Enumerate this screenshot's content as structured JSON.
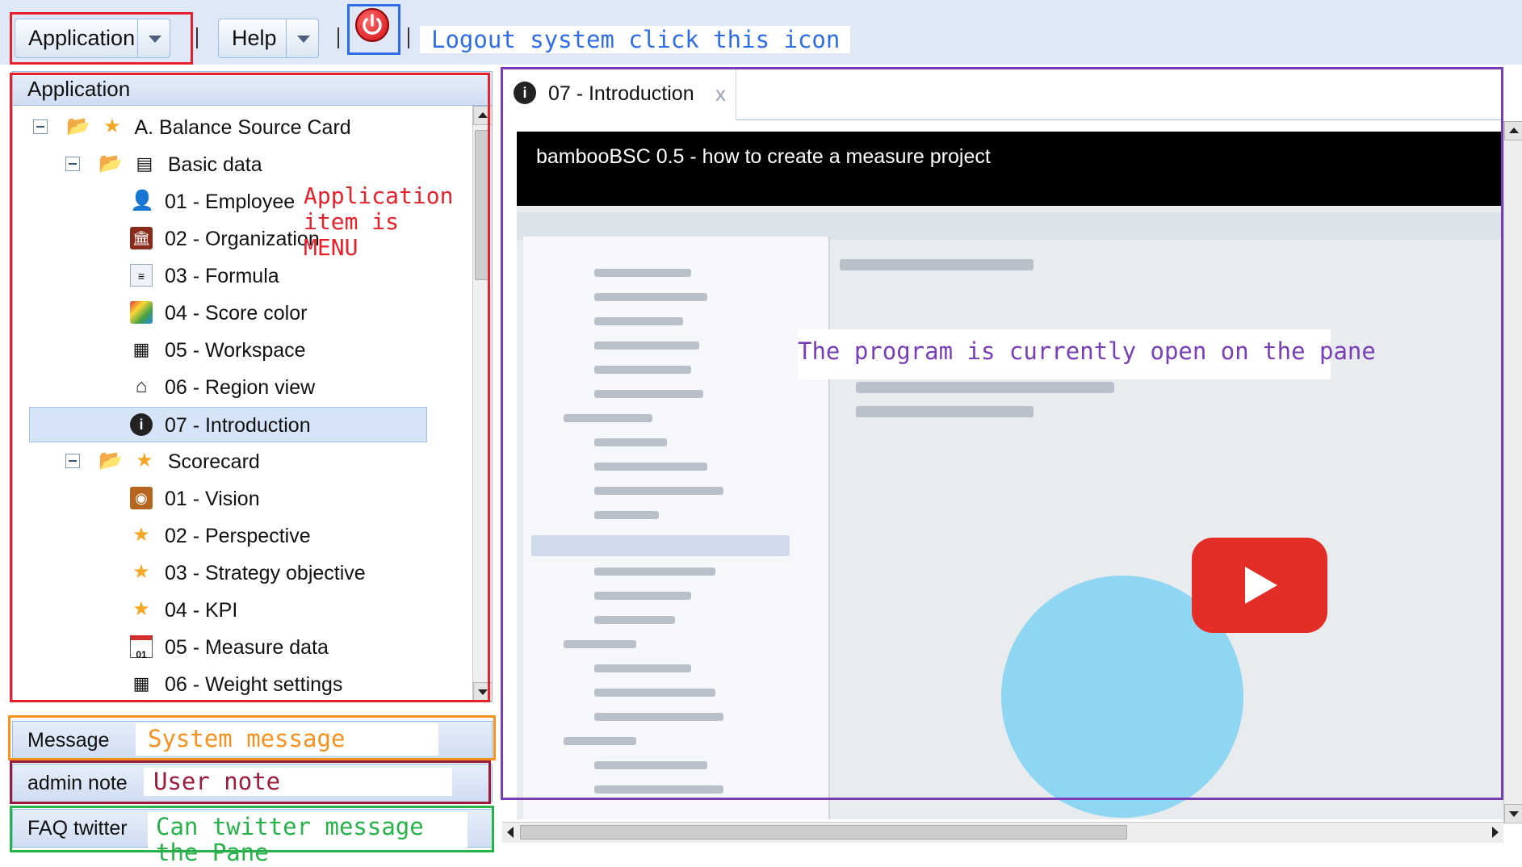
{
  "toolbar": {
    "application_label": "Application",
    "help_label": "Help",
    "logout_annotation": "Logout system click this icon"
  },
  "sidebar": {
    "header": "Application",
    "annotation": "Application item is MENU",
    "tree": [
      {
        "label": "A. Balance Source Card",
        "icon": "star-icon"
      },
      {
        "label": "Basic data",
        "icon": "document-icon"
      },
      {
        "label": "01 - Employee",
        "icon": "person-icon"
      },
      {
        "label": "02 - Organization",
        "icon": "building-icon"
      },
      {
        "label": "03 - Formula",
        "icon": "formula-icon"
      },
      {
        "label": "04 - Score color",
        "icon": "palette-icon"
      },
      {
        "label": "05 - Workspace",
        "icon": "grid-icon"
      },
      {
        "label": "06 - Region view",
        "icon": "house-icon"
      },
      {
        "label": "07 - Introduction",
        "icon": "info-icon"
      },
      {
        "label": "Scorecard",
        "icon": "star-icon"
      },
      {
        "label": "01 - Vision",
        "icon": "eye-icon"
      },
      {
        "label": "02 - Perspective",
        "icon": "star-icon"
      },
      {
        "label": "03 - Strategy objective",
        "icon": "star-icon"
      },
      {
        "label": "04 - KPI",
        "icon": "star-icon"
      },
      {
        "label": "05 - Measure data",
        "icon": "calendar-icon"
      },
      {
        "label": "06 - Weight settings",
        "icon": "grid-icon"
      }
    ]
  },
  "panels": {
    "message_label": "Message",
    "message_annotation": "System message",
    "admin_note_label": "admin note",
    "admin_note_annotation": "User note",
    "faq_label": "FAQ twitter",
    "faq_annotation": "Can twitter message the Pane"
  },
  "content": {
    "tab_label": "07 - Introduction",
    "tab_close": "x",
    "video_title": "bambooBSC 0.5 - how to create a measure project",
    "pane_annotation": "The program is currently open on the pane",
    "calendar_day": "01"
  },
  "colors": {
    "menu_annotation": "#e8202a",
    "logout_annotation": "#2d6ee8",
    "pane_annotation": "#7a3db8",
    "message_annotation": "#f6911e",
    "note_annotation": "#9c1b3c",
    "faq_annotation": "#27b24a"
  }
}
